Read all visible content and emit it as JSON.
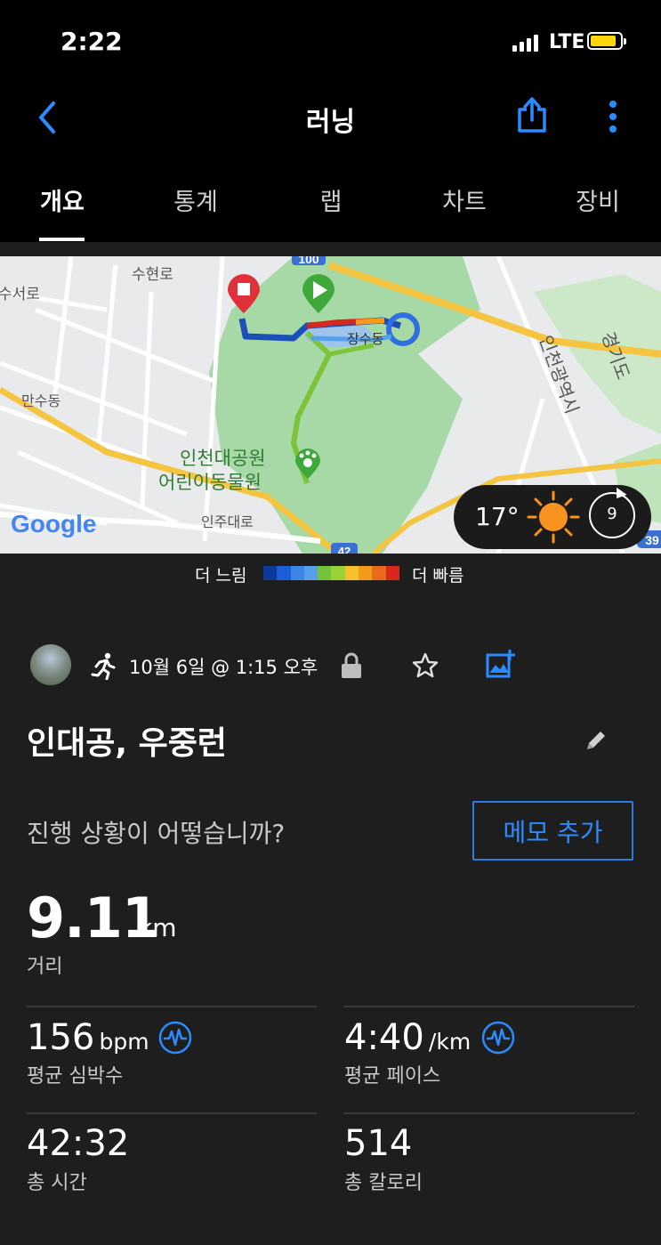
{
  "status_bar": {
    "time": "2:22",
    "network": "LTE"
  },
  "header": {
    "title": "러닝"
  },
  "tabs": [
    {
      "label": "개요",
      "active": true
    },
    {
      "label": "통계"
    },
    {
      "label": "랩"
    },
    {
      "label": "차트"
    },
    {
      "label": "장비"
    }
  ],
  "map": {
    "labels": {
      "suhyeon_ro": "수현로",
      "susu_ro": "수서로",
      "mansu_dong": "만수동",
      "jangsu_dong": "장수동",
      "incheon_city": "인천광역시",
      "gyeonggi": "경기도",
      "park_line1": "인천대공원",
      "park_line2": "어린이동물원",
      "inju_ro": "인주대로",
      "shield_100": "100",
      "shield_42": "42",
      "shield_39": "39",
      "google": "Google"
    },
    "weather": {
      "temp": "17°",
      "wind": "9"
    }
  },
  "legend": {
    "slow": "더 느림",
    "fast": "더 빠름",
    "colors": [
      "#0b3a9a",
      "#1a5fd6",
      "#3c86e8",
      "#55a0e8",
      "#74c23a",
      "#9ad136",
      "#f3c22c",
      "#f29b1b",
      "#ea6a1c",
      "#d8281e"
    ]
  },
  "activity": {
    "date": "10월 6일 @ 1:15 오후",
    "name": "인대공, 우중런",
    "question": "진행 상황이 어떻습니까?",
    "memo_button": "메모 추가"
  },
  "stats": {
    "distance": {
      "value": "9.11",
      "unit": "km",
      "label": "거리"
    },
    "heart_rate": {
      "value": "156",
      "unit": "bpm",
      "label": "평균 심박수"
    },
    "pace": {
      "value": "4:40",
      "unit": "/km",
      "label": "평균 페이스"
    },
    "time": {
      "value": "42:32",
      "label": "총 시간"
    },
    "calories": {
      "value": "514",
      "label": "총 칼로리"
    }
  }
}
